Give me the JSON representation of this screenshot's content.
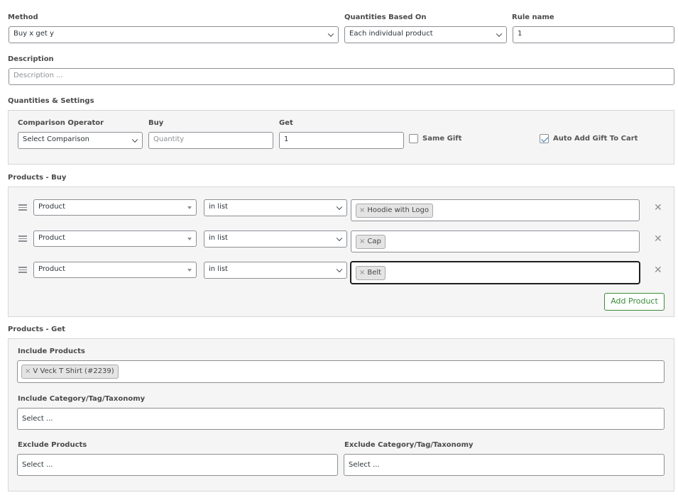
{
  "method": {
    "label": "Method",
    "value": "Buy x get y"
  },
  "quantities_based_on": {
    "label": "Quantities Based On",
    "value": "Each individual product"
  },
  "rule_name": {
    "label": "Rule name",
    "value": "1"
  },
  "description": {
    "label": "Description",
    "placeholder": "Description ..."
  },
  "quantities_settings": {
    "title": "Quantities & Settings",
    "comparison_operator": {
      "label": "Comparison Operator",
      "value": "Select Comparison"
    },
    "buy": {
      "label": "Buy",
      "placeholder": "Quantity"
    },
    "get": {
      "label": "Get",
      "value": "1"
    },
    "same_gift": {
      "label": "Same Gift",
      "checked": false
    },
    "auto_add_gift": {
      "label": "Auto Add Gift To Cart",
      "checked": true
    }
  },
  "products_buy": {
    "title": "Products - Buy",
    "rows": [
      {
        "type": "Product",
        "condition": "in list",
        "chip": "Hoodie with Logo"
      },
      {
        "type": "Product",
        "condition": "in list",
        "chip": "Cap"
      },
      {
        "type": "Product",
        "condition": "in list",
        "chip": "Belt"
      }
    ],
    "remove_glyph": "✕",
    "chip_remove_glyph": "×",
    "add_button": "Add Product"
  },
  "products_get": {
    "title": "Products - Get",
    "include_products": {
      "label": "Include Products",
      "chip": "V Veck T Shirt (#2239)"
    },
    "include_category": {
      "label": "Include Category/Tag/Taxonomy",
      "placeholder": "Select ..."
    },
    "exclude_products": {
      "label": "Exclude Products",
      "placeholder": "Select ..."
    },
    "exclude_category": {
      "label": "Exclude Category/Tag/Taxonomy",
      "placeholder": "Select ..."
    }
  },
  "colors": {
    "accent_green": "#3a8b3a",
    "checkbox_blue": "#2271b1",
    "panel_bg": "#f5f5f5"
  }
}
